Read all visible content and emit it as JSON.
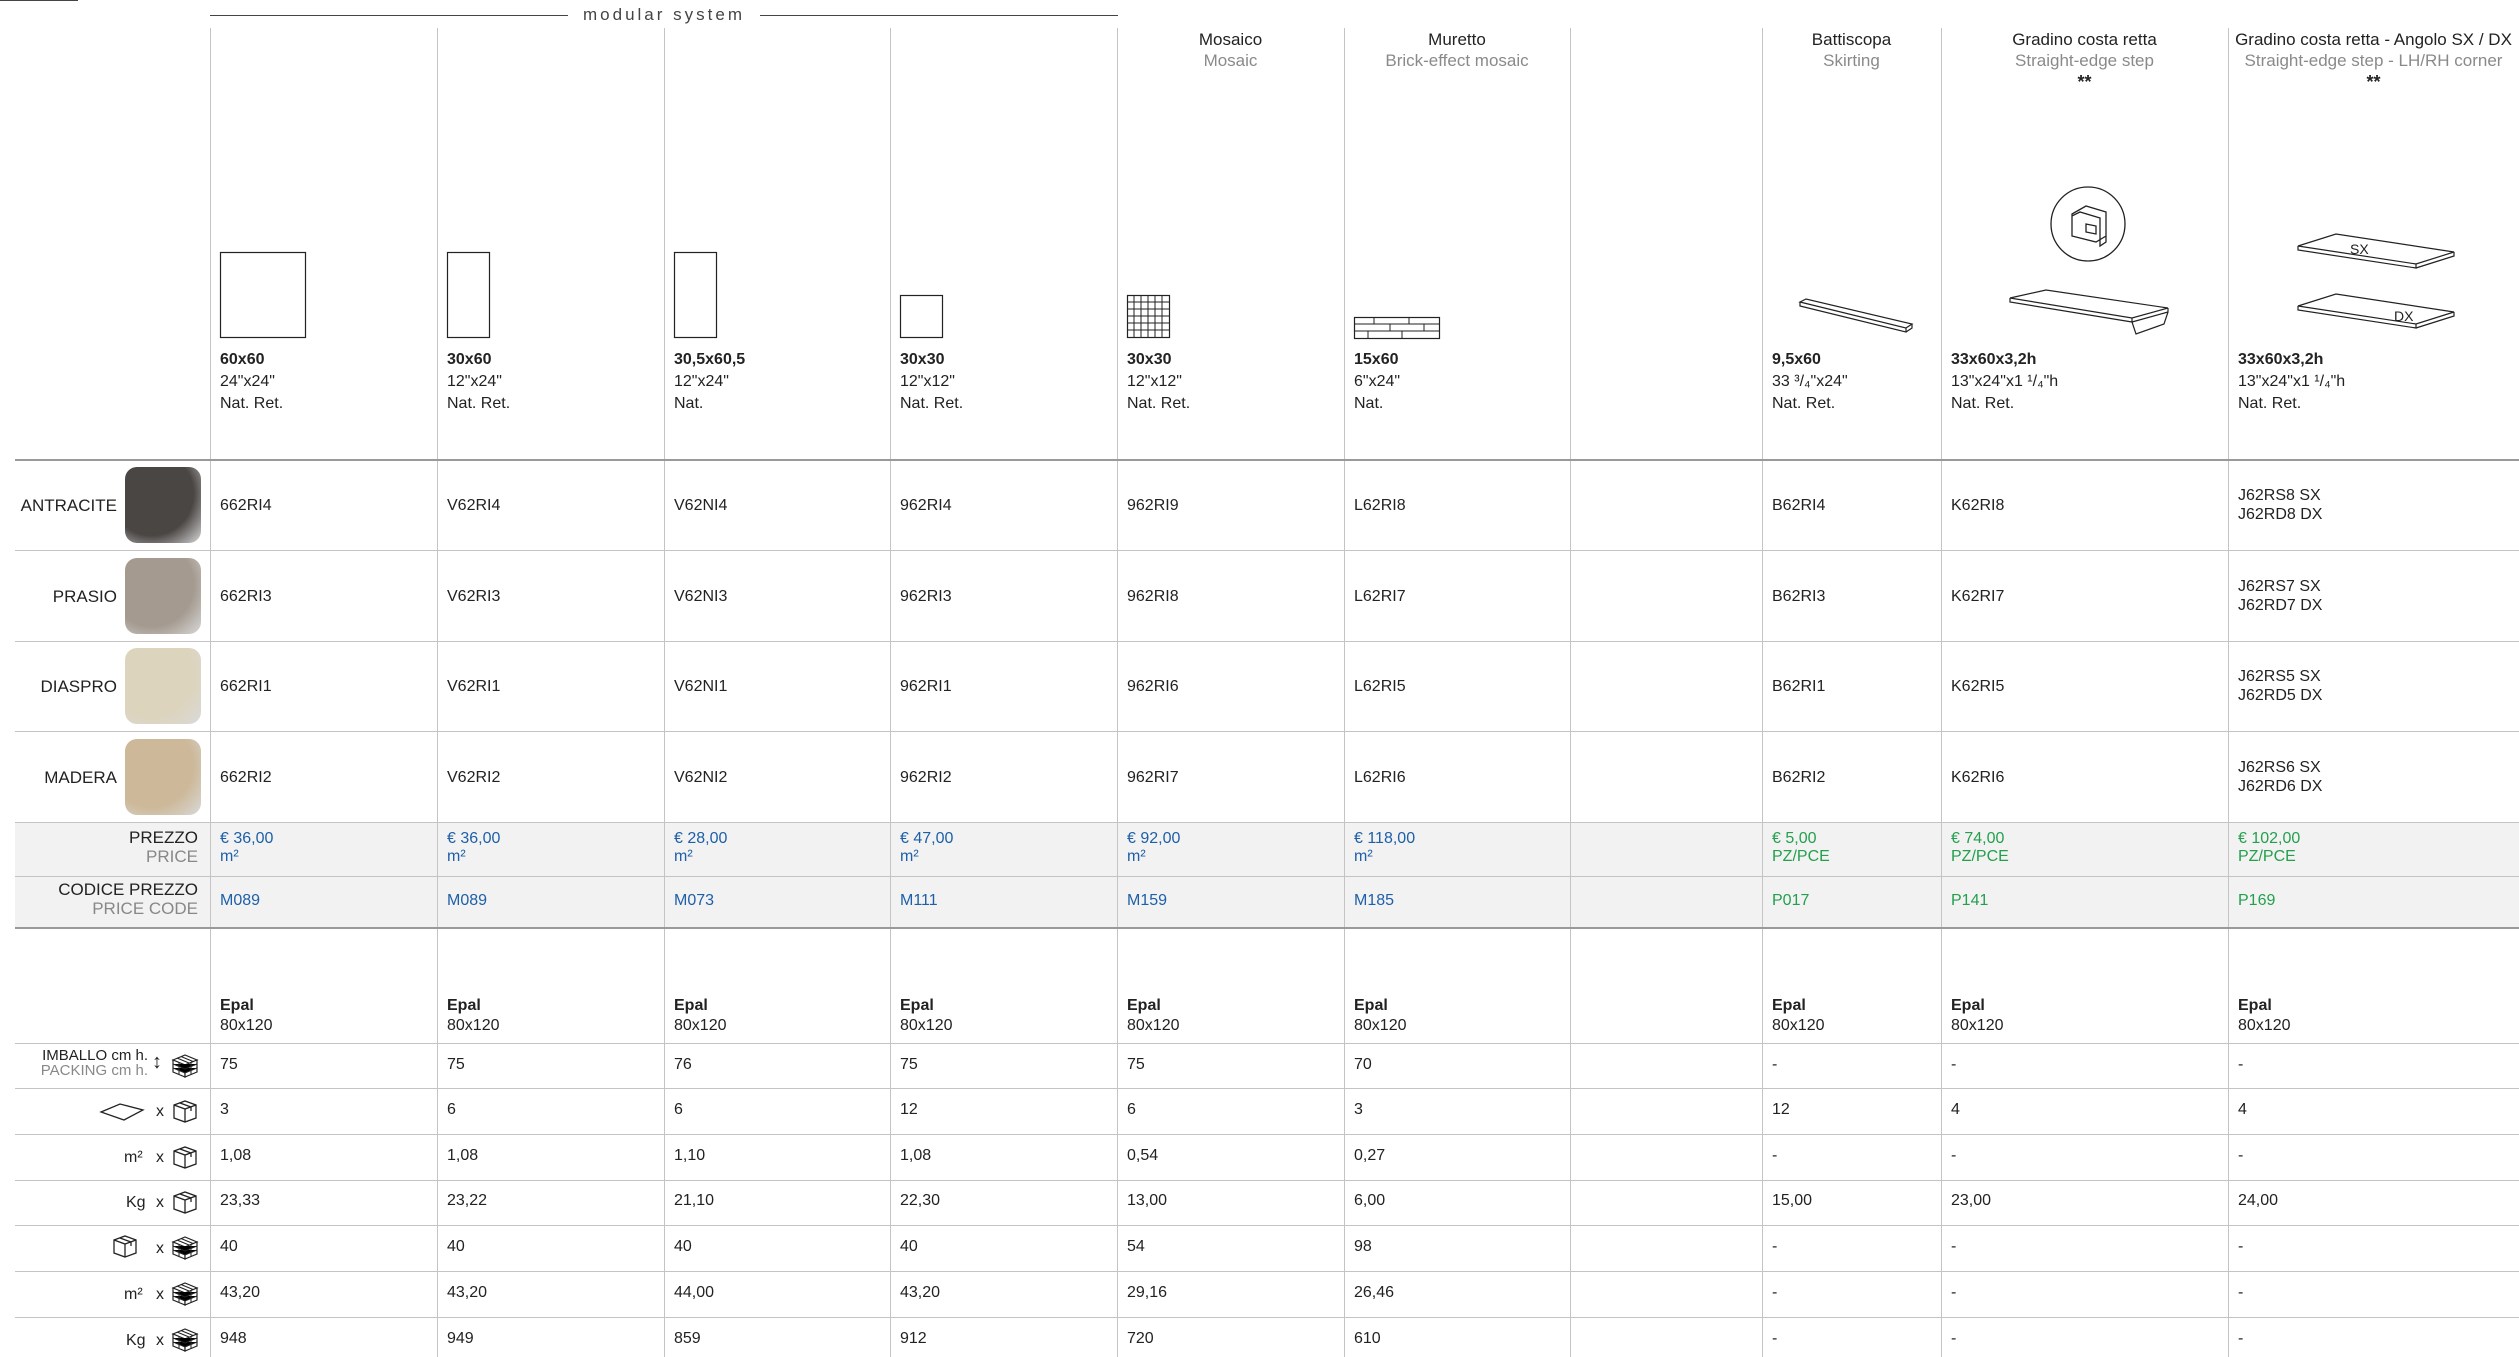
{
  "header": {
    "modular_system": "modular system"
  },
  "columns": [
    {
      "title": "",
      "subtitle": "",
      "stars": "",
      "size": "60x60",
      "imperial": "24\"x24\"",
      "finish": "Nat. Ret.",
      "price": "€ 36,00",
      "unit": "m²",
      "price_code": "M089",
      "pallet": "Epal",
      "pallet_size": "80x120",
      "packing": [
        "75",
        "3",
        "1,08",
        "23,33",
        "40",
        "43,20",
        "948"
      ],
      "codes": [
        "662RI4",
        "662RI3",
        "662RI1",
        "662RI2"
      ]
    },
    {
      "title": "",
      "subtitle": "",
      "stars": "",
      "size": "30x60",
      "imperial": "12\"x24\"",
      "finish": "Nat. Ret.",
      "price": "€ 36,00",
      "unit": "m²",
      "price_code": "M089",
      "pallet": "Epal",
      "pallet_size": "80x120",
      "packing": [
        "75",
        "6",
        "1,08",
        "23,22",
        "40",
        "43,20",
        "949"
      ],
      "codes": [
        "V62RI4",
        "V62RI3",
        "V62RI1",
        "V62RI2"
      ]
    },
    {
      "title": "",
      "subtitle": "",
      "stars": "",
      "size": "30,5x60,5",
      "imperial": "12\"x24\"",
      "finish": "Nat.",
      "price": "€ 28,00",
      "unit": "m²",
      "price_code": "M073",
      "pallet": "Epal",
      "pallet_size": "80x120",
      "packing": [
        "76",
        "6",
        "1,10",
        "21,10",
        "40",
        "44,00",
        "859"
      ],
      "codes": [
        "V62NI4",
        "V62NI3",
        "V62NI1",
        "V62NI2"
      ]
    },
    {
      "title": "",
      "subtitle": "",
      "stars": "",
      "size": "30x30",
      "imperial": "12\"x12\"",
      "finish": "Nat. Ret.",
      "price": "€ 47,00",
      "unit": "m²",
      "price_code": "M111",
      "pallet": "Epal",
      "pallet_size": "80x120",
      "packing": [
        "75",
        "12",
        "1,08",
        "22,30",
        "40",
        "43,20",
        "912"
      ],
      "codes": [
        "962RI4",
        "962RI3",
        "962RI1",
        "962RI2"
      ]
    },
    {
      "title": "Mosaico",
      "subtitle": "Mosaic",
      "stars": "",
      "size": "30x30",
      "imperial": "12\"x12\"",
      "finish": "Nat. Ret.",
      "price": "€ 92,00",
      "unit": "m²",
      "price_code": "M159",
      "pallet": "Epal",
      "pallet_size": "80x120",
      "packing": [
        "75",
        "6",
        "0,54",
        "13,00",
        "54",
        "29,16",
        "720"
      ],
      "codes": [
        "962RI9",
        "962RI8",
        "962RI6",
        "962RI7"
      ]
    },
    {
      "title": "Muretto",
      "subtitle": "Brick-effect mosaic",
      "stars": "",
      "size": "15x60",
      "imperial": "6\"x24\"",
      "finish": "Nat.",
      "price": "€ 118,00",
      "unit": "m²",
      "price_code": "M185",
      "pallet": "Epal",
      "pallet_size": "80x120",
      "packing": [
        "70",
        "3",
        "0,27",
        "6,00",
        "98",
        "26,46",
        "610"
      ],
      "codes": [
        "L62RI8",
        "L62RI7",
        "L62RI5",
        "L62RI6"
      ]
    },
    {
      "title": "Battiscopa",
      "subtitle": "Skirting",
      "stars": "",
      "size": "9,5x60",
      "imperial": "33 ³/₄\"x24\"",
      "finish": "Nat. Ret.",
      "price": "€ 5,00",
      "unit": "PZ/PCE",
      "price_code": "P017",
      "pallet": "Epal",
      "pallet_size": "80x120",
      "packing": [
        "-",
        "12",
        "-",
        "15,00",
        "-",
        "-",
        "-"
      ],
      "codes": [
        "B62RI4",
        "B62RI3",
        "B62RI1",
        "B62RI2"
      ]
    },
    {
      "title": "Gradino costa retta",
      "subtitle": "Straight-edge step",
      "stars": "**",
      "size": "33x60x3,2h",
      "imperial": "13\"x24\"x1 ¹/₄\"h",
      "finish": "Nat. Ret.",
      "price": "€ 74,00",
      "unit": "PZ/PCE",
      "price_code": "P141",
      "pallet": "Epal",
      "pallet_size": "80x120",
      "packing": [
        "-",
        "4",
        "-",
        "23,00",
        "-",
        "-",
        "-"
      ],
      "codes": [
        "K62RI8",
        "K62RI7",
        "K62RI5",
        "K62RI6"
      ]
    },
    {
      "title": "Gradino costa retta - Angolo SX / DX",
      "subtitle": "Straight-edge step - LH/RH corner",
      "stars": "**",
      "size": "33x60x3,2h",
      "imperial": "13\"x24\"x1 ¹/₄\"h",
      "finish": "Nat. Ret.",
      "price": "€ 102,00",
      "unit": "PZ/PCE",
      "price_code": "P169",
      "pallet": "Epal",
      "pallet_size": "80x120",
      "packing": [
        "-",
        "4",
        "-",
        "24,00",
        "-",
        "-",
        "-"
      ],
      "codes": [
        "J62RS8 SX\nJ62RD8 DX",
        "J62RS7 SX\nJ62RD7 DX",
        "J62RS5 SX\nJ62RD5 DX",
        "J62RS6 SX\nJ62RD6 DX"
      ]
    }
  ],
  "colors": [
    {
      "name": "ANTRACITE",
      "swatch": "#4a4644"
    },
    {
      "name": "PRASIO",
      "swatch": "#a49a8f"
    },
    {
      "name": "DIASPRO",
      "swatch": "#ddd4bd"
    },
    {
      "name": "MADERA",
      "swatch": "#cdb99a"
    }
  ],
  "labels": {
    "prezzo": "PREZZO",
    "price": "PRICE",
    "codice_prezzo": "CODICE PREZZO",
    "price_code": "PRICE CODE",
    "imballo": "IMBALLO cm h.",
    "packing": "PACKING cm h.",
    "m2": "m²",
    "kg": "Kg",
    "x": "x",
    "sx": "SX",
    "dx": "DX"
  },
  "accent_blue": "#1d5fa8",
  "accent_green": "#23a04d"
}
